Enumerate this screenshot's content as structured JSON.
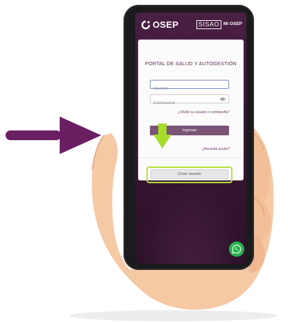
{
  "header": {
    "brand": "OSEP",
    "sisao": "SISAO",
    "mi_osep": "Mi OSEP"
  },
  "login": {
    "title": "PORTAL DE SALUD Y AUTOGESTIÓN",
    "username_placeholder": "Usuario",
    "password_placeholder": "Contraseña",
    "forgot_link": "¿Olvidó su usuario o contraseña?",
    "submit_label": "Ingresar",
    "help_link": "¿Necesita ayuda?",
    "create_user_label": "Crear usuario"
  },
  "colors": {
    "brand_purple": "#3b1736",
    "button_purple": "#7a5577",
    "highlight_green": "#b6e23a",
    "annotation_arrow": "#6b1f63",
    "whatsapp_green": "#29b24e"
  },
  "icons": {
    "logo": "osep-logo-icon",
    "password_toggle": "eye-icon",
    "chat": "whatsapp-icon",
    "left_arrow": "arrow-right-icon",
    "down_arrow": "arrow-down-icon"
  }
}
